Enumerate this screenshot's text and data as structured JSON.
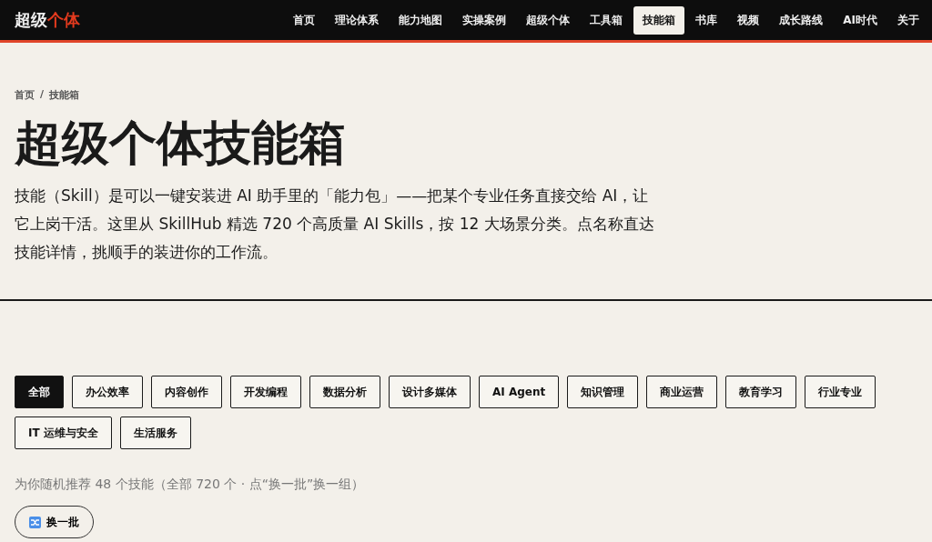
{
  "logo": [
    {
      "text": "超级",
      "accent": false
    },
    {
      "text": "个体",
      "accent": true
    }
  ],
  "nav": [
    {
      "label": "首页",
      "selected": false
    },
    {
      "label": "理论体系",
      "selected": false
    },
    {
      "label": "能力地图",
      "selected": false
    },
    {
      "label": "实操案例",
      "selected": false
    },
    {
      "label": "超级个体",
      "selected": false
    },
    {
      "label": "工具箱",
      "selected": false
    },
    {
      "label": "技能箱",
      "selected": true
    },
    {
      "label": "书库",
      "selected": false
    },
    {
      "label": "视频",
      "selected": false
    },
    {
      "label": "成长路线",
      "selected": false
    },
    {
      "label": "AI时代",
      "selected": false
    },
    {
      "label": "关于",
      "selected": false
    }
  ],
  "breadcrumb": {
    "separator": "/",
    "items": [
      "首页",
      "技能箱"
    ]
  },
  "title": "超级个体技能箱",
  "intro": "技能（Skill）是可以一键安装进 AI 助手里的「能力包」——把某个专业任务直接交给 AI，让它上岗干活。这里从 SkillHub 精选 720 个高质量 AI Skills，按 12 大场景分类。点名称直达技能详情，挑顺手的装进你的工作流。",
  "filters": [
    {
      "label": "全部",
      "selected": true
    },
    {
      "label": "办公效率",
      "selected": false
    },
    {
      "label": "内容创作",
      "selected": false
    },
    {
      "label": "开发编程",
      "selected": false
    },
    {
      "label": "数据分析",
      "selected": false
    },
    {
      "label": "设计多媒体",
      "selected": false
    },
    {
      "label": "AI Agent",
      "selected": false
    },
    {
      "label": "知识管理",
      "selected": false
    },
    {
      "label": "商业运营",
      "selected": false
    },
    {
      "label": "教育学习",
      "selected": false
    },
    {
      "label": "行业专业",
      "selected": false
    },
    {
      "label": "IT 运维与安全",
      "selected": false
    },
    {
      "label": "生活服务",
      "selected": false
    }
  ],
  "summary": "为你随机推荐 48 个技能（全部 720 个 · 点“换一批”换一组）",
  "shuffle_button": "换一批"
}
